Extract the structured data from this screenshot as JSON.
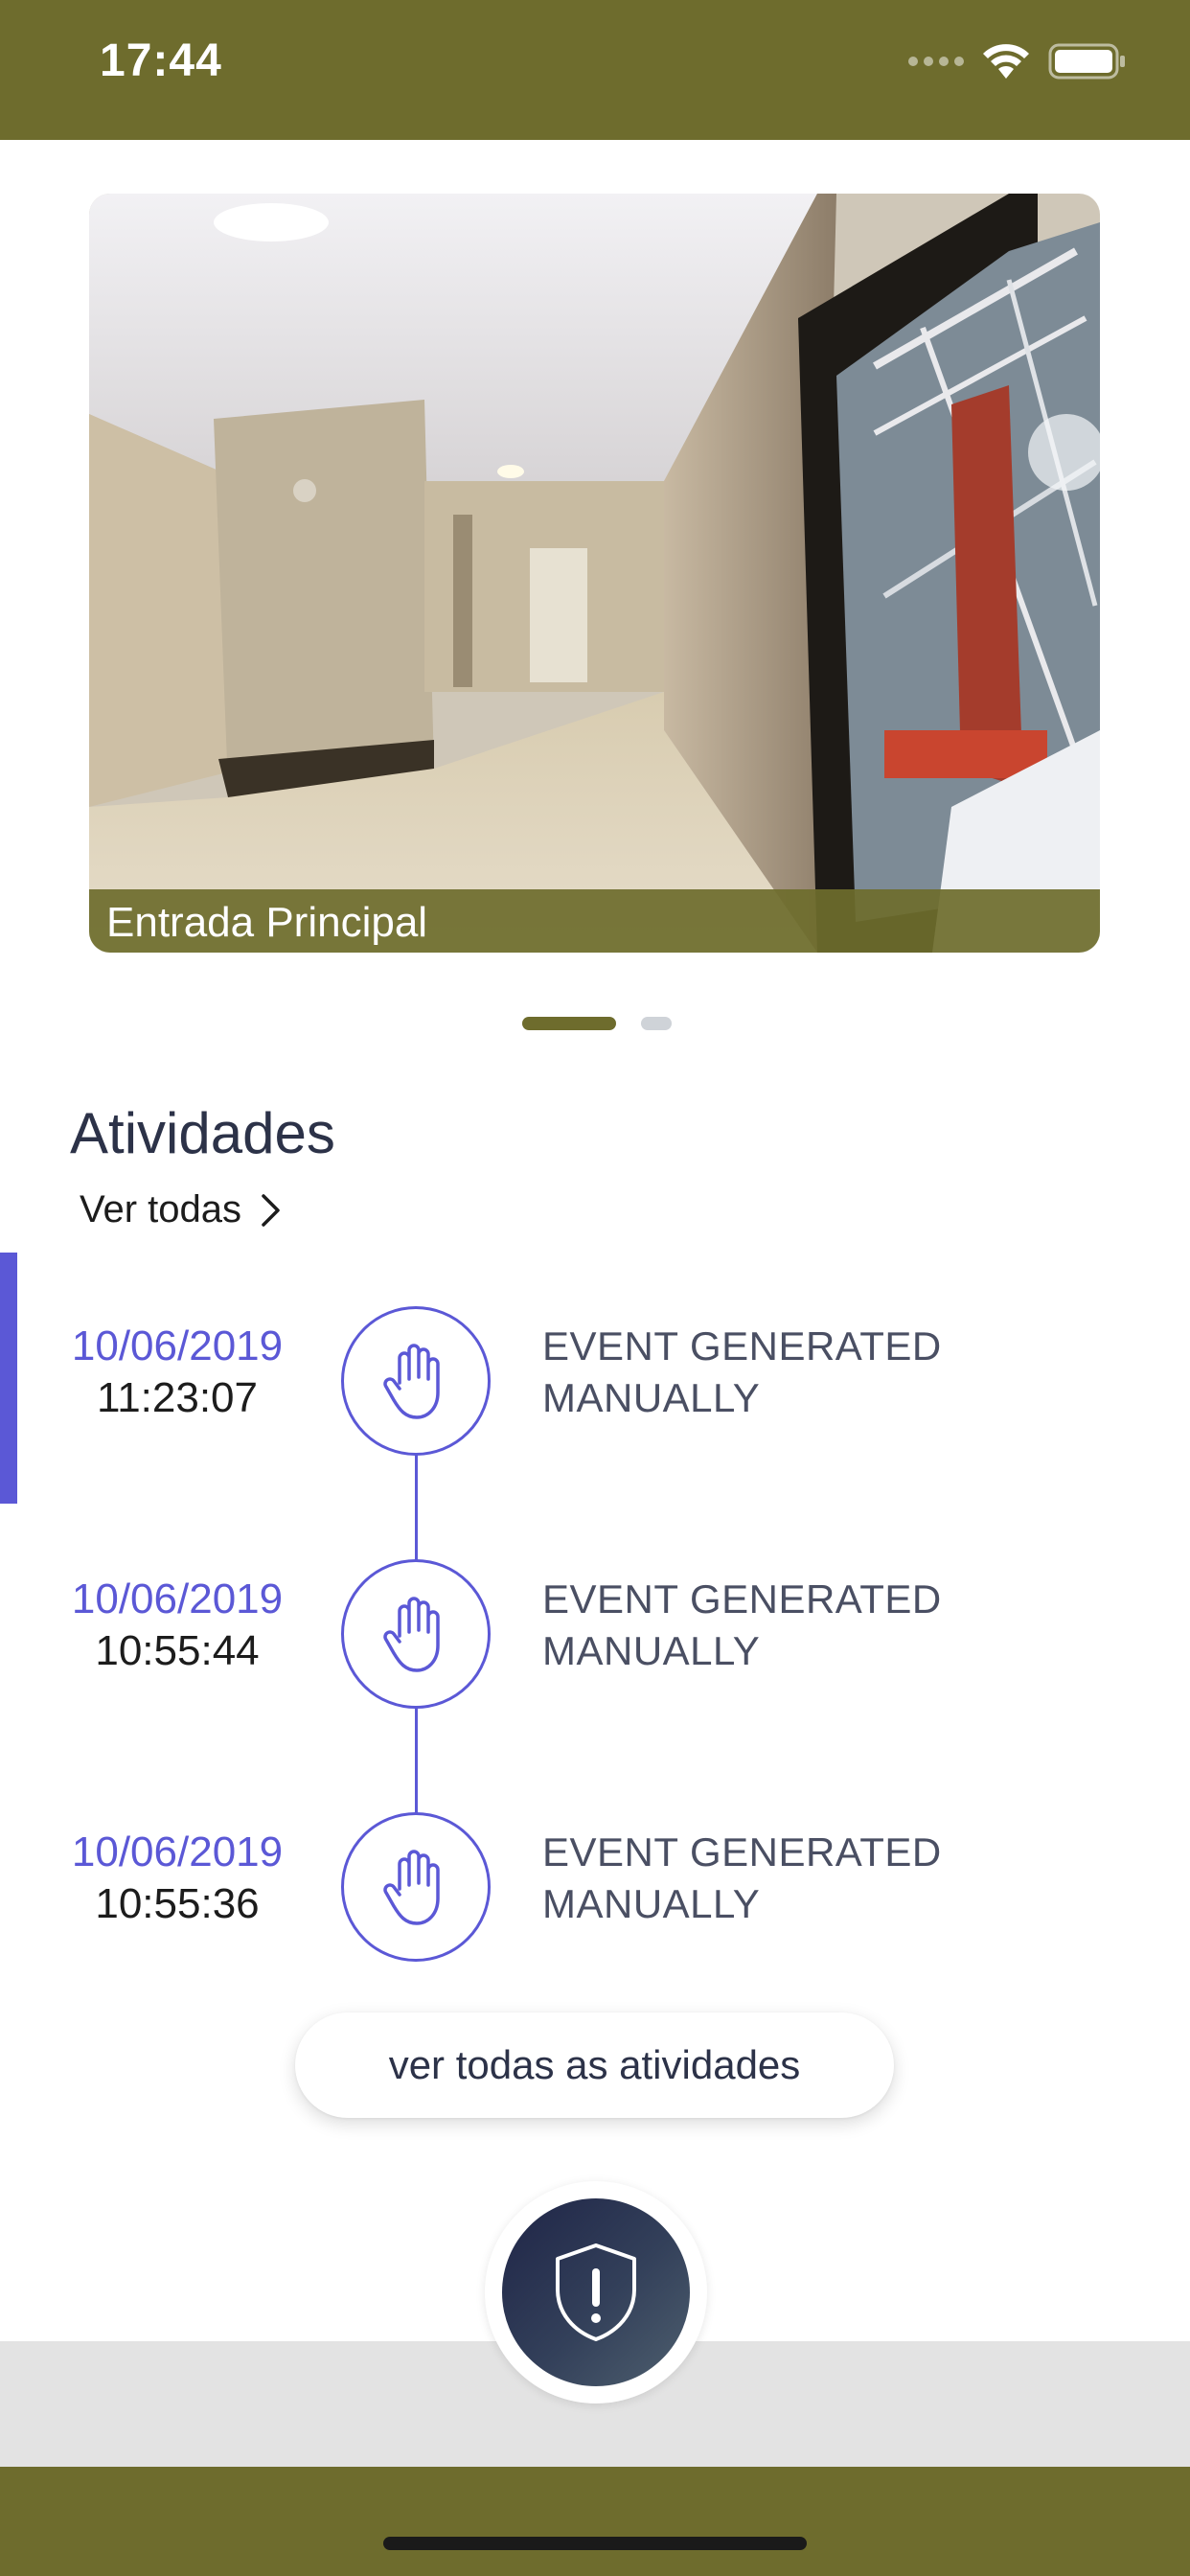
{
  "status_bar": {
    "time": "17:44",
    "icons": [
      "cellular-signal-icon",
      "wifi-icon",
      "battery-icon"
    ]
  },
  "camera": {
    "caption": "Entrada Principal",
    "pager": {
      "active_index": 0,
      "count": 2
    }
  },
  "activities": {
    "title": "Atividades",
    "see_all_label": "Ver todas",
    "events": [
      {
        "date": "10/06/2019",
        "time": "11:23:07",
        "description_line1": "EVENT GENERATED",
        "description_line2": "MANUALLY",
        "icon": "hand-icon"
      },
      {
        "date": "10/06/2019",
        "time": "10:55:44",
        "description_line1": "EVENT GENERATED",
        "description_line2": "MANUALLY",
        "icon": "hand-icon"
      },
      {
        "date": "10/06/2019",
        "time": "10:55:36",
        "description_line1": "EVENT GENERATED",
        "description_line2": "MANUALLY",
        "icon": "hand-icon"
      }
    ],
    "all_activities_button": "ver todas as atividades"
  },
  "panic_button": {
    "icon": "shield-alert-icon"
  },
  "colors": {
    "brand_olive": "#6e6c2d",
    "accent_purple": "#5b58d6",
    "title_dark": "#2c3248"
  }
}
